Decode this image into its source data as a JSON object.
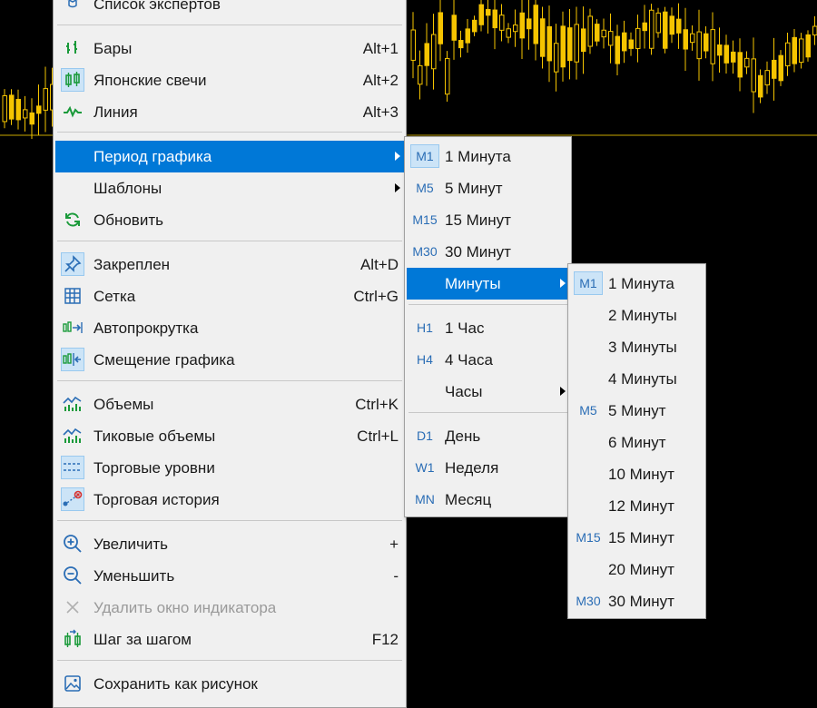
{
  "main_menu": {
    "items": [
      {
        "label": "Список экспертов",
        "accel": "",
        "icon": "expert-list-icon"
      },
      {
        "label": "Бары",
        "accel": "Alt+1",
        "icon": "bars-icon"
      },
      {
        "label": "Японские свечи",
        "accel": "Alt+2",
        "icon": "candlesticks-icon",
        "checked": true
      },
      {
        "label": "Линия",
        "accel": "Alt+3",
        "icon": "line-chart-icon"
      },
      {
        "label": "Период графика",
        "accel": "",
        "submenu": true,
        "highlighted": true
      },
      {
        "label": "Шаблоны",
        "accel": "",
        "submenu": true
      },
      {
        "label": "Обновить",
        "accel": "",
        "icon": "refresh-icon"
      },
      {
        "label": "Закреплен",
        "accel": "Alt+D",
        "icon": "pin-icon",
        "checked": true
      },
      {
        "label": "Сетка",
        "accel": "Ctrl+G",
        "icon": "grid-icon"
      },
      {
        "label": "Автопрокрутка",
        "accel": "",
        "icon": "autoscroll-icon"
      },
      {
        "label": "Смещение графика",
        "accel": "",
        "icon": "chart-shift-icon",
        "checked": true
      },
      {
        "label": "Объемы",
        "accel": "Ctrl+K",
        "icon": "volumes-icon"
      },
      {
        "label": "Тиковые объемы",
        "accel": "Ctrl+L",
        "icon": "tick-volumes-icon"
      },
      {
        "label": "Торговые уровни",
        "accel": "",
        "icon": "trade-levels-icon",
        "checked": true
      },
      {
        "label": "Торговая история",
        "accel": "",
        "icon": "trade-history-icon",
        "checked": true
      },
      {
        "label": "Увеличить",
        "accel": "+",
        "icon": "zoom-in-icon"
      },
      {
        "label": "Уменьшить",
        "accel": "-",
        "icon": "zoom-out-icon"
      },
      {
        "label": "Удалить окно индикатора",
        "accel": "",
        "icon": "delete-icon",
        "disabled": true
      },
      {
        "label": "Шаг за шагом",
        "accel": "F12",
        "icon": "step-icon"
      },
      {
        "label": "Сохранить как рисунок",
        "accel": "",
        "icon": "save-picture-icon"
      }
    ]
  },
  "period_menu": {
    "items": [
      {
        "tf": "M1",
        "label": "1 Минута",
        "checked": true
      },
      {
        "tf": "M5",
        "label": "5 Минут"
      },
      {
        "tf": "M15",
        "label": "15 Минут"
      },
      {
        "tf": "M30",
        "label": "30 Минут"
      },
      {
        "tf": "",
        "label": "Минуты",
        "submenu": true,
        "highlighted": true
      },
      {
        "tf": "H1",
        "label": "1 Час"
      },
      {
        "tf": "H4",
        "label": "4 Часа"
      },
      {
        "tf": "",
        "label": "Часы",
        "submenu": true
      },
      {
        "tf": "D1",
        "label": "День"
      },
      {
        "tf": "W1",
        "label": "Неделя"
      },
      {
        "tf": "MN",
        "label": "Месяц"
      }
    ]
  },
  "minutes_menu": {
    "items": [
      {
        "tf": "M1",
        "label": "1 Минута",
        "checked": true
      },
      {
        "tf": "",
        "label": "2 Минуты"
      },
      {
        "tf": "",
        "label": "3 Минуты"
      },
      {
        "tf": "",
        "label": "4 Минуты"
      },
      {
        "tf": "M5",
        "label": "5 Минут"
      },
      {
        "tf": "",
        "label": "6 Минут"
      },
      {
        "tf": "",
        "label": "10 Минут"
      },
      {
        "tf": "",
        "label": "12 Минут"
      },
      {
        "tf": "M15",
        "label": "15 Минут"
      },
      {
        "tf": "",
        "label": "20 Минут"
      },
      {
        "tf": "M30",
        "label": "30 Минут"
      }
    ]
  },
  "colors": {
    "candle": "#f5c400",
    "price_line": "#c8a800",
    "menu_bg": "#f0f0f0",
    "highlight": "#0078d7"
  }
}
